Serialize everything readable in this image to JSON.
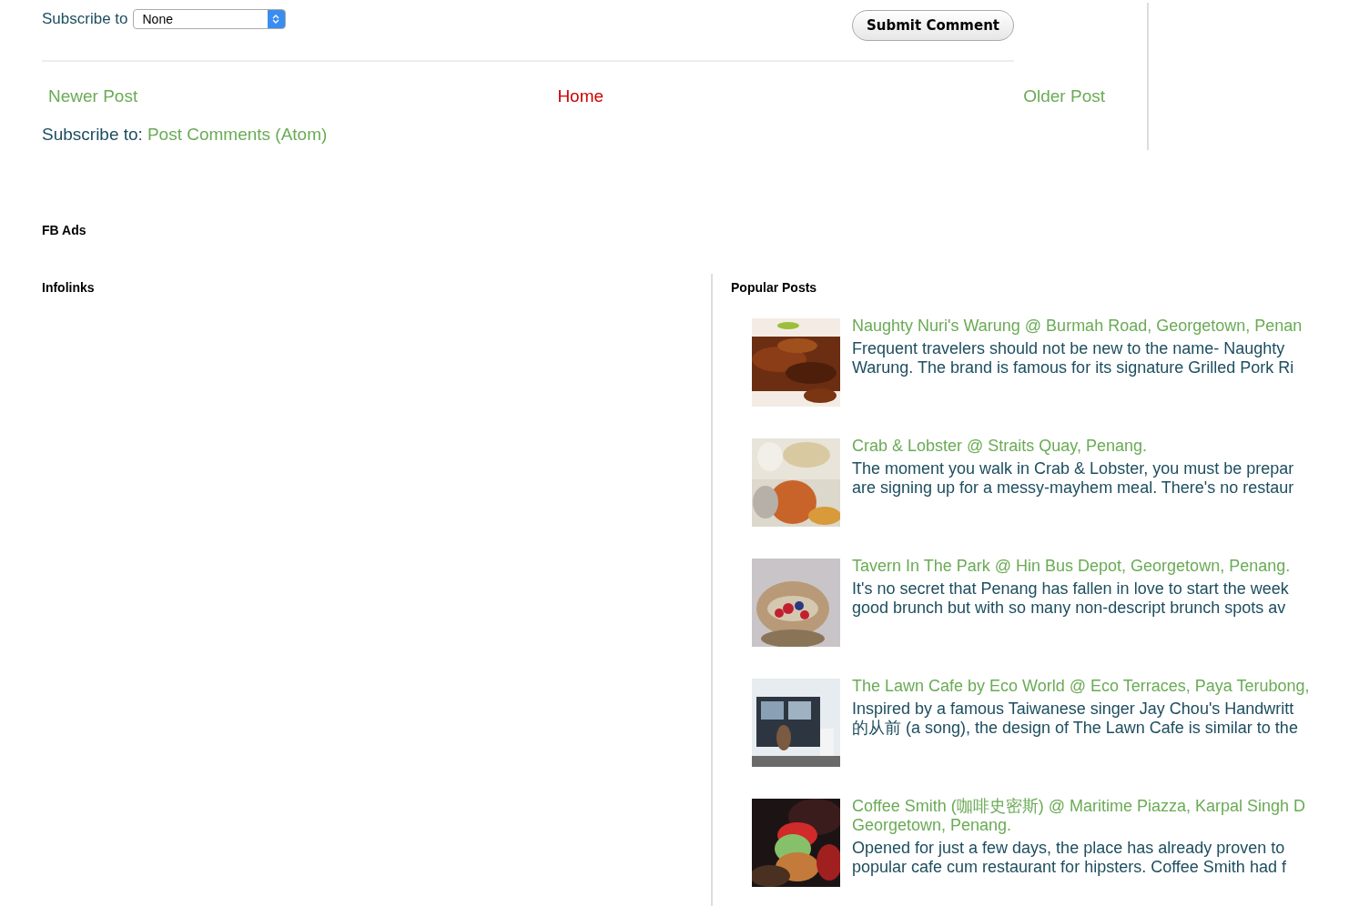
{
  "comment_form": {
    "subscribe_label": "Subscribe to",
    "subscribe_select": {
      "value": "None"
    },
    "submit_button": "Submit Comment"
  },
  "post_nav": {
    "newer": "Newer Post",
    "home": "Home",
    "older": "Older Post"
  },
  "feed_links": {
    "label": "Subscribe to:",
    "link": "Post Comments (Atom)"
  },
  "fb_ads": {
    "title": "FB Ads"
  },
  "infolinks": {
    "title": "Infolinks"
  },
  "popular_posts": {
    "title": "Popular Posts",
    "items": [
      {
        "kind": "picture",
        "title_lines": [
          "Naughty Nuri's Warung @ Burmah Road, Georgetown, Penan"
        ],
        "snippet_lines": [
          "Frequent travelers should not be new to the name- Naughty",
          "Warung. The brand is famous for its signature Grilled Pork Ri"
        ]
      },
      {
        "kind": "picture",
        "title_lines": [
          "Crab & Lobster @ Straits Quay, Penang."
        ],
        "snippet_lines": [
          "The moment you walk in Crab & Lobster, you must be prepar",
          "are signing up for a messy-mayhem meal. There's no restaur"
        ]
      },
      {
        "kind": "picture",
        "title_lines": [
          "Tavern In The Park @ Hin Bus Depot, Georgetown, Penang."
        ],
        "snippet_lines": [
          "It's no secret that Penang has fallen in love to start the week",
          "good brunch but with so many non-descript brunch spots av"
        ]
      },
      {
        "kind": "picture",
        "title_lines": [
          "The Lawn Cafe by Eco World @ Eco Terraces, Paya Terubong,"
        ],
        "snippet_lines": [
          "Inspired by a famous Taiwanese singer Jay Chou's Handwritt",
          "的从前  (a song), the design of The Lawn Cafe is similar to the"
        ]
      },
      {
        "kind": "picture",
        "title_lines": [
          "Coffee Smith (咖啡史密斯) @ Maritime Piazza, Karpal Singh D",
          "Georgetown, Penang."
        ],
        "snippet_lines": [
          "Opened for just a few days, the place has already proven to",
          "popular cafe cum restaurant for hipsters. Coffee Smith had f"
        ]
      }
    ]
  }
}
